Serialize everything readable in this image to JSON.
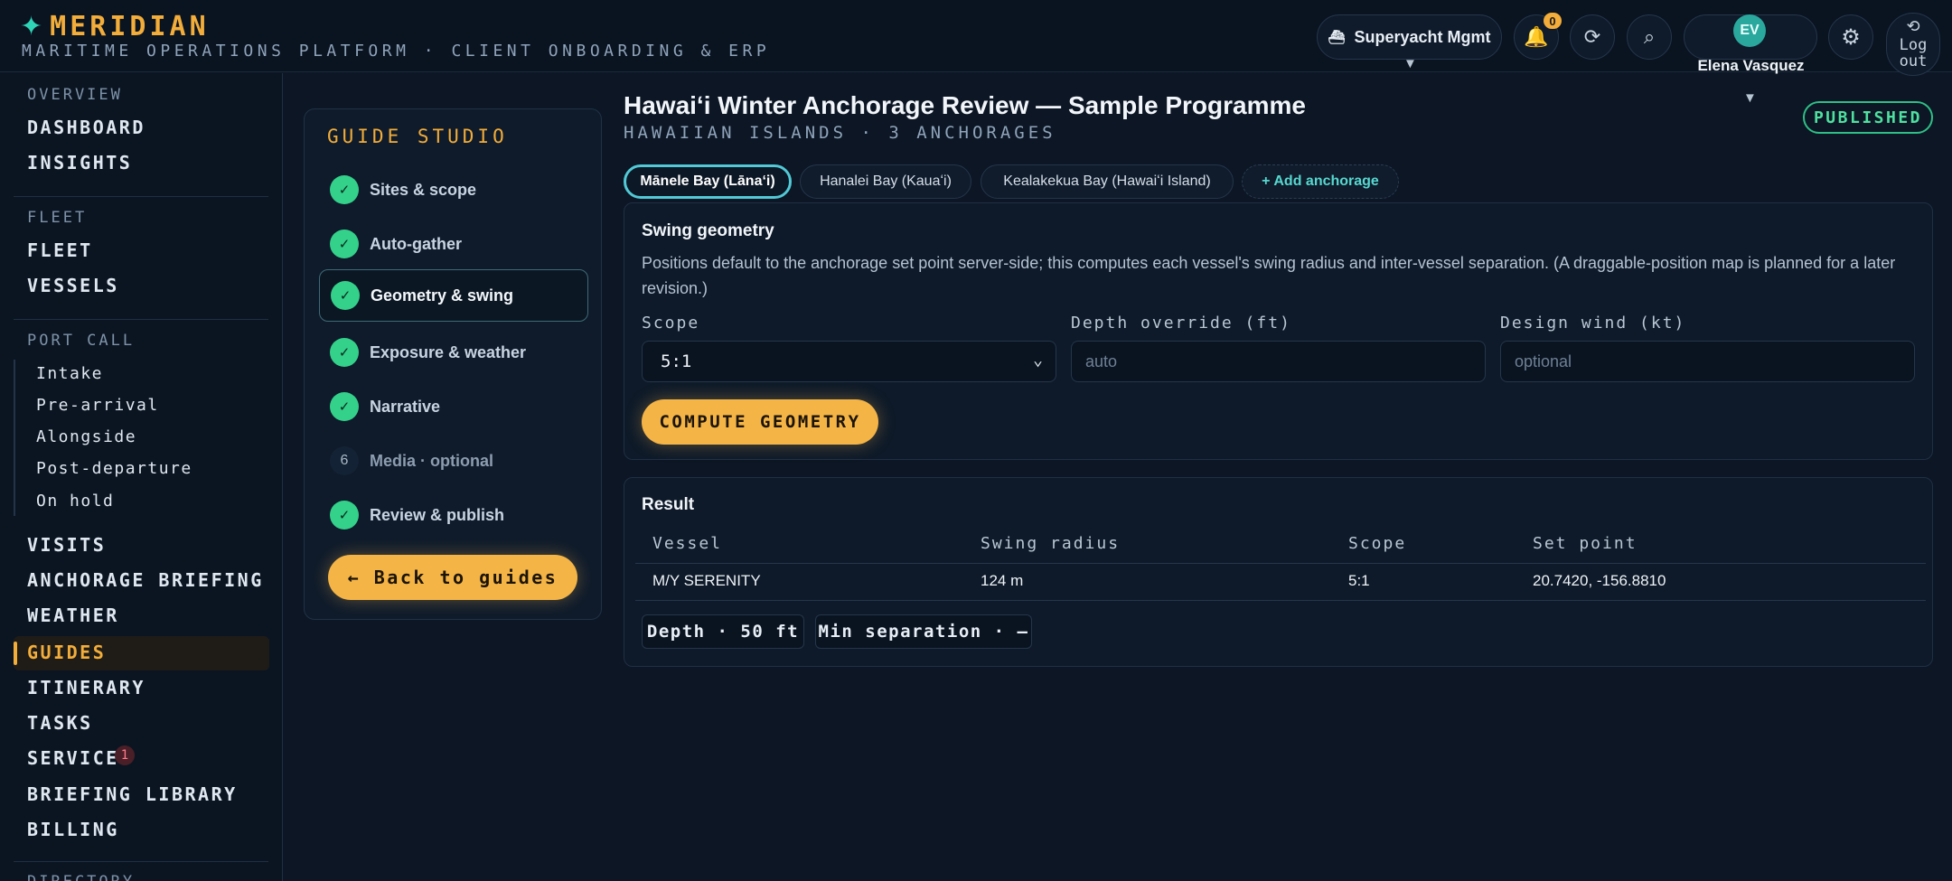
{
  "header": {
    "brand": "MERIDIAN",
    "subtitle": "MARITIME OPERATIONS PLATFORM · CLIENT ONBOARDING & ERP",
    "org_icon": "⛴",
    "org_name": "Superyacht Mgmt",
    "notifications_count": "0",
    "user_initials": "EV",
    "user_name": "Elena Vasquez",
    "logout_label": "Log out",
    "icons": [
      "sparkle-icon",
      "ship-icon",
      "bell-icon",
      "refresh-icon",
      "search-icon",
      "gear-icon",
      "logout-icon"
    ]
  },
  "sidebar": {
    "overview_heading": "OVERVIEW",
    "dashboard": "DASHBOARD",
    "insights": "INSIGHTS",
    "fleet_heading": "FLEET",
    "fleet": "FLEET",
    "vessels": "VESSELS",
    "port_call_heading": "PORT CALL",
    "port_call_items": [
      "Intake",
      "Pre-arrival",
      "Alongside",
      "Post-departure",
      "On hold"
    ],
    "visits": "VISITS",
    "anchorage_briefing": "ANCHORAGE BRIEFING",
    "weather": "WEATHER",
    "guides": "GUIDES",
    "itinerary": "ITINERARY",
    "tasks": "TASKS",
    "service": "SERVICE",
    "service_badge": "1",
    "briefing_library": "BRIEFING LIBRARY",
    "billing": "BILLING",
    "directory_heading": "DIRECTORY"
  },
  "studio": {
    "title": "GUIDE STUDIO",
    "steps": [
      {
        "label": "Sites & scope",
        "status": "done"
      },
      {
        "label": "Auto-gather",
        "status": "done"
      },
      {
        "label": "Geometry & swing",
        "status": "done"
      },
      {
        "label": "Exposure & weather",
        "status": "done"
      },
      {
        "label": "Narrative",
        "status": "done"
      },
      {
        "label": "Media · optional",
        "status": "pending",
        "number": "6"
      },
      {
        "label": "Review & publish",
        "status": "done"
      }
    ],
    "check_glyph": "✓",
    "back_label": "← Back to guides"
  },
  "main": {
    "title": "Hawaiʻi Winter Anchorage Review — Sample Programme",
    "subtitle": "HAWAIIAN ISLANDS · 3 ANCHORAGES",
    "status_badge": "PUBLISHED",
    "tabs": [
      "Mānele Bay (Lānaʻi)",
      "Hanalei Bay (Kauaʻi)",
      "Kealakekua Bay (Hawaiʻi Island)"
    ],
    "add_tab": "+ Add anchorage",
    "geometry": {
      "title": "Swing geometry",
      "description": "Positions default to the anchorage set point server-side; this computes each vessel's swing radius and inter-vessel separation. (A draggable-position map is planned for a later revision.)",
      "scope_label": "Scope",
      "scope_value": "5:1",
      "depth_label": "Depth override (ft)",
      "depth_placeholder": "auto",
      "wind_label": "Design wind (kt)",
      "wind_placeholder": "optional",
      "compute_label": "COMPUTE GEOMETRY"
    },
    "result": {
      "title": "Result",
      "columns": [
        "Vessel",
        "Swing radius",
        "Scope",
        "Set point"
      ],
      "rows": [
        {
          "vessel": "M/Y SERENITY",
          "swing_radius": "124 m",
          "scope": "5:1",
          "set_point": "20.7420, -156.8810"
        }
      ],
      "depth_chip": "Depth · 50 ft",
      "separation_chip": "Min separation · —"
    }
  },
  "colors": {
    "accent": "#f2ad3a",
    "teal": "#2fd3b6",
    "success": "#33d18a",
    "background": "#0c1624"
  }
}
